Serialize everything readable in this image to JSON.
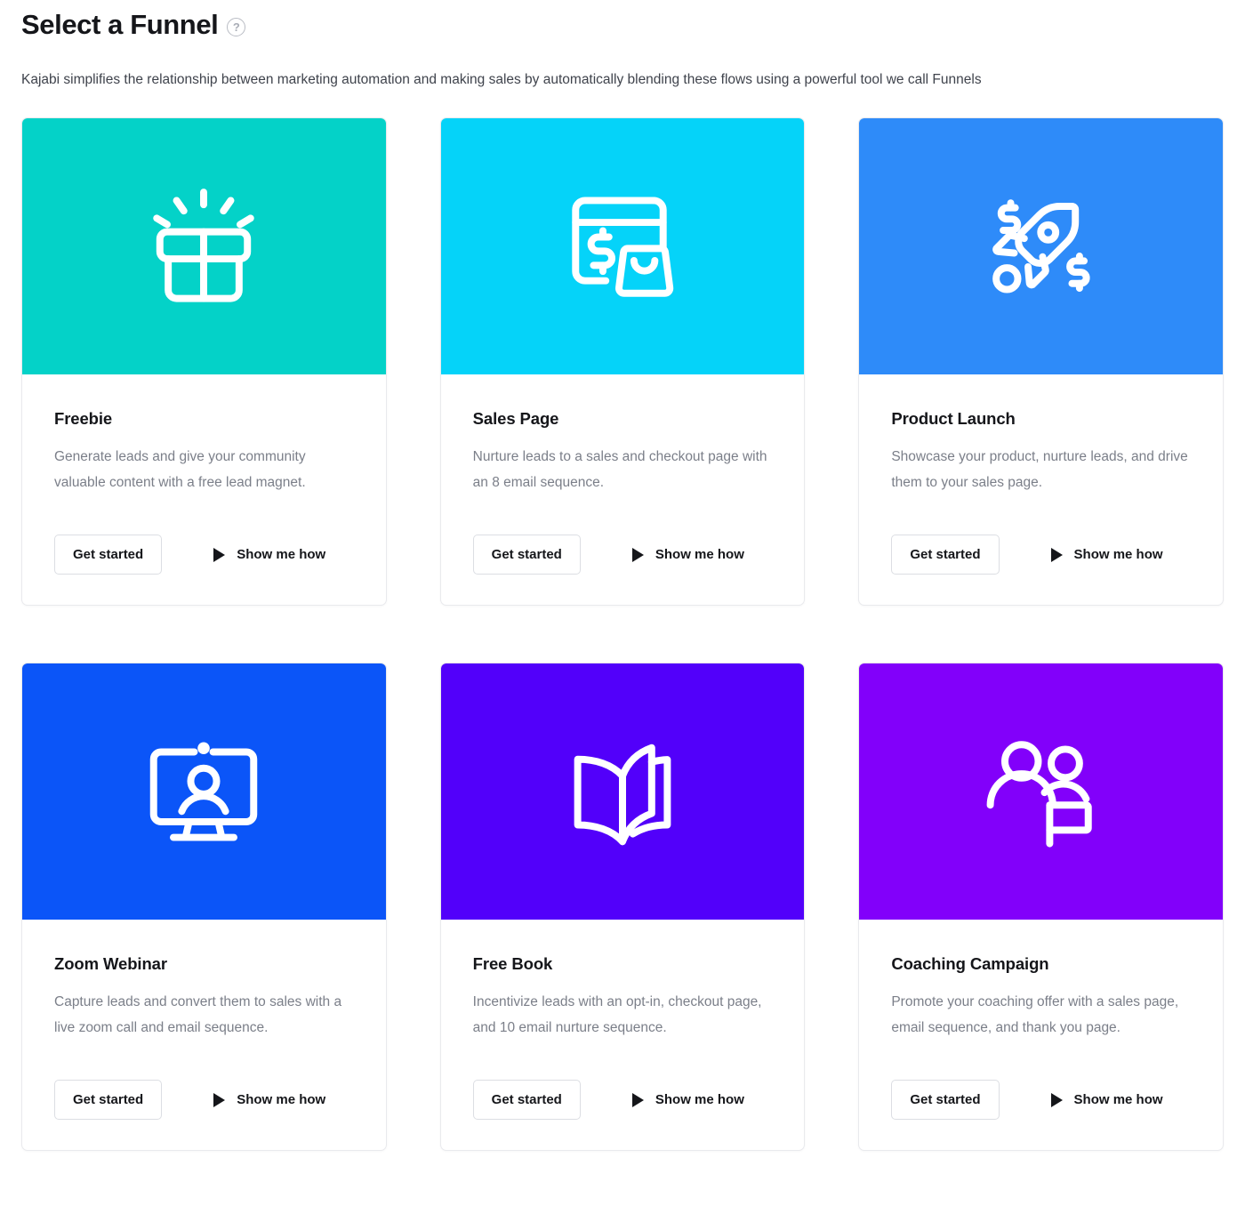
{
  "header": {
    "title": "Select a Funnel",
    "help_icon": "question-mark-circle-icon",
    "help_glyph": "?",
    "subtitle": "Kajabi simplifies the relationship between marketing automation and making sales by automatically blending these flows using a powerful tool we call Funnels"
  },
  "actions": {
    "get_started_label": "Get started",
    "show_me_how_label": "Show me how",
    "play_icon": "play-triangle-icon"
  },
  "cards": [
    {
      "id": "freebie",
      "title": "Freebie",
      "description": "Generate leads and give your community valuable content with a free lead magnet.",
      "icon": "gift-icon",
      "banner_color": "#04d2c8"
    },
    {
      "id": "sales-page",
      "title": "Sales Page",
      "description": "Nurture leads to a sales and checkout page with an 8 email sequence.",
      "icon": "browser-checkout-icon",
      "banner_color": "#05d3f9"
    },
    {
      "id": "product-launch",
      "title": "Product Launch",
      "description": "Showcase your product, nurture leads, and drive them to your sales page.",
      "icon": "rocket-dollar-icon",
      "banner_color": "#2e8bf9"
    },
    {
      "id": "zoom-webinar",
      "title": "Zoom Webinar",
      "description": "Capture leads and convert them to sales with a live zoom call and email sequence.",
      "icon": "monitor-person-icon",
      "banner_color": "#0b55f8"
    },
    {
      "id": "free-book",
      "title": "Free Book",
      "description": "Incentivize leads with an opt-in, checkout page, and 10 email nurture sequence.",
      "icon": "open-book-icon",
      "banner_color": "#5200fa"
    },
    {
      "id": "coaching-campaign",
      "title": "Coaching Campaign",
      "description": "Promote your coaching offer with a sales page, email sequence, and thank you page.",
      "icon": "people-flag-icon",
      "banner_color": "#8200fa"
    }
  ]
}
